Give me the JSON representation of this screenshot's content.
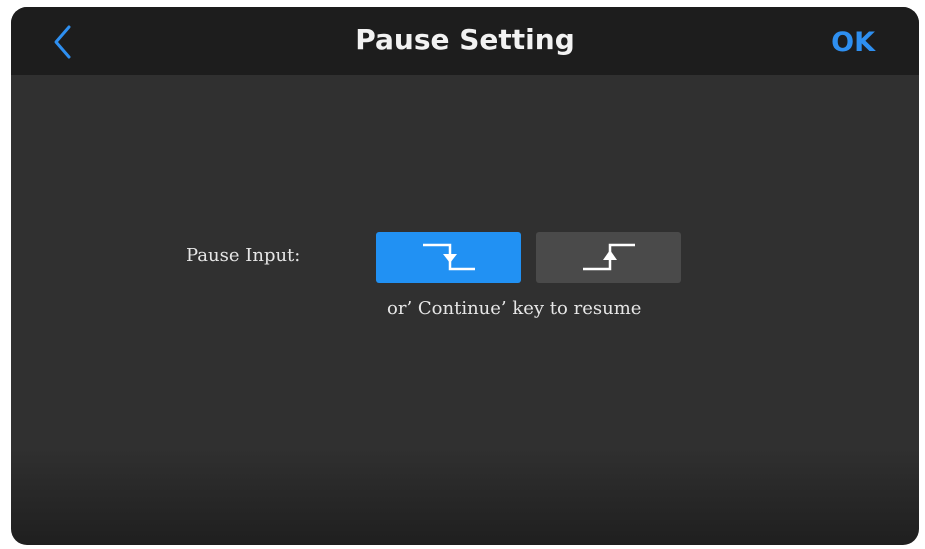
{
  "header": {
    "title": "Pause Setting",
    "back_icon": "chevron-left-icon",
    "ok_label": "OK"
  },
  "pause_input": {
    "label": "Pause Input:",
    "options": [
      {
        "icon": "falling-edge-icon",
        "selected": true
      },
      {
        "icon": "rising-edge-icon",
        "selected": false
      }
    ],
    "hint": "or’ Continue’ key to resume"
  },
  "colors": {
    "accent": "#2191f3",
    "ok_text": "#2e8ff0",
    "background": "#303030",
    "header": "#1d1d1d",
    "unselected_button": "#4a4a4a"
  }
}
